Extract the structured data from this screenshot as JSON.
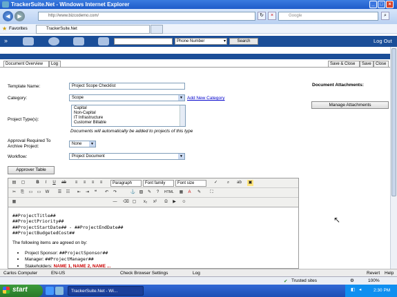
{
  "window": {
    "title": "TrackerSuite.Net - Windows Internet Explorer"
  },
  "browser": {
    "url": "http://www.bizcodemo.com/",
    "search_placeholder": "Google",
    "favorites_label": "Favorites",
    "tab_title": "TrackerSuite.Net"
  },
  "app": {
    "search_type": "Phone Number",
    "search_button": "Search",
    "logout": "Log Out"
  },
  "tabs": {
    "document_overview": "Document Overview",
    "log": "Log",
    "save_close": "Save & Close",
    "save": "Save",
    "close": "Close"
  },
  "form": {
    "template_name_label": "Template Name:",
    "template_name_value": "Project Scope Checklist",
    "category_label": "Category:",
    "category_value": "Scope",
    "add_category": "Add New Category",
    "project_types_label": "Project Type(s):",
    "project_types": [
      "Capital",
      "Non-Capital",
      "IT Infrastructure",
      "Customer Billable"
    ],
    "project_types_note": "Documents will automatically be added to projects of this type",
    "approval_label_1": "Approval Required To",
    "approval_label_2": "Archive Project:",
    "approval_value": "None",
    "workflow_label": "Workflow:",
    "workflow_value": "Project Document",
    "approver_table_button": "Approver Table",
    "attachments_title": "Document Attachments:",
    "manage_attachments": "Manage Attachments"
  },
  "editor": {
    "format_select": "Paragraph",
    "font_family_select": "Font family",
    "font_size_select": "Font size",
    "lines": [
      "##ProjectTitle##",
      "##ProjectPriority##",
      "##ProjectStartDate## - ##ProjectEndDate##",
      "##ProjectBudgetedCost##"
    ],
    "agreed_text": "The following items are agreed on by:",
    "bullets": [
      {
        "label": "Project Sponsor: ",
        "value": "##ProjectSponsor##"
      },
      {
        "label": "Manager: ",
        "value": "##ProjectManager##"
      },
      {
        "label": "Stakeholders: ",
        "value": "NAME 1, NAME 2, NAME ..."
      }
    ],
    "stakeholder_color": "#cc0000"
  },
  "statusbar": {
    "user": "Carlos Computer",
    "locale": "EN-US",
    "check_settings": "Check Browser Settings",
    "log": "Log",
    "revert": "Revert",
    "help": "Help"
  },
  "ie_status": {
    "zone": "Trusted sites",
    "zoom": "100%"
  },
  "taskbar": {
    "start": "start",
    "task_title": "TrackerSuite.Net - Wi...",
    "clock": "2:30 PM"
  }
}
